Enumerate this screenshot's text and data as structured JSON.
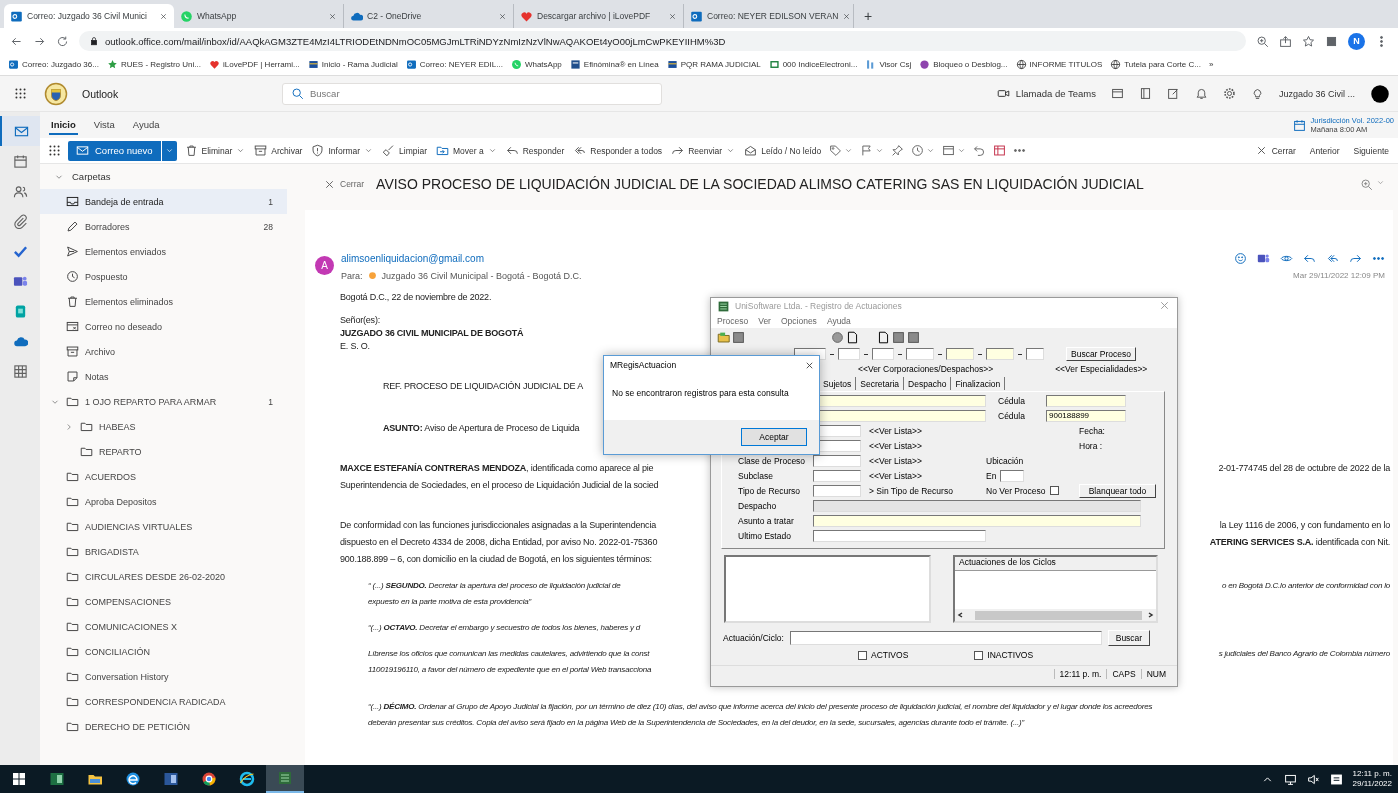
{
  "browser": {
    "tabs": [
      {
        "title": "Correo: Juzgado 36 Civil Munici",
        "kind": "outlook",
        "selected": true
      },
      {
        "title": "WhatsApp",
        "kind": "whatsapp",
        "selected": false
      },
      {
        "title": "C2 - OneDrive",
        "kind": "onedrive",
        "selected": false
      },
      {
        "title": "Descargar archivo | iLovePDF",
        "kind": "ilovepdf",
        "selected": false
      },
      {
        "title": "Correo: NEYER EDILSON VERAN",
        "kind": "outlook",
        "selected": false
      }
    ],
    "new_tab": "+",
    "url": "outlook.office.com/mail/inbox/id/AAQkAGM3ZTE4MzI4LTRIODEtNDNmOC05MGJmLTRiNDYzNmIzNzVlNwAQAKOEt4yO00jLmCwPKEYIIHM%3D",
    "profile_initial": "N",
    "bookmarks": [
      {
        "label": "Correo: Juzgado 36...",
        "kind": "outlook"
      },
      {
        "label": "RUES - Registro Uni...",
        "kind": "rues"
      },
      {
        "label": "iLovePDF | Herrami...",
        "kind": "ilovepdf"
      },
      {
        "label": "Inicio - Rama Judicial",
        "kind": "rama"
      },
      {
        "label": "Correo: NEYER EDIL...",
        "kind": "outlook"
      },
      {
        "label": "WhatsApp",
        "kind": "whatsapp"
      },
      {
        "label": "Efinómina® en Línea",
        "kind": "efinomina"
      },
      {
        "label": "PQR RAMA JUDICIAL",
        "kind": "rama"
      },
      {
        "label": "000 IndiceElectroni...",
        "kind": "indice"
      },
      {
        "label": "Visor Csj",
        "kind": "visor"
      },
      {
        "label": "Bloqueo o Desblog...",
        "kind": "bloqueo"
      },
      {
        "label": "INFORME TITULOS",
        "kind": "globe"
      },
      {
        "label": "Tutela para Corte C...",
        "kind": "globe"
      }
    ],
    "more_bookmarks": "»"
  },
  "outlook": {
    "app_name": "Outlook",
    "search": {
      "placeholder": "Buscar"
    },
    "teams_call": "Llamada de Teams",
    "account": "Juzgado 36 Civil ...",
    "app_rail": [
      {
        "kind": "mail",
        "selected": true
      },
      {
        "kind": "calendar",
        "selected": false
      },
      {
        "kind": "people",
        "selected": false
      },
      {
        "kind": "attachment",
        "selected": false
      },
      {
        "kind": "todo",
        "selected": false
      },
      {
        "kind": "teams",
        "selected": false
      },
      {
        "kind": "bookings",
        "selected": false
      },
      {
        "kind": "onedrive",
        "selected": false
      },
      {
        "kind": "apps",
        "selected": false
      }
    ],
    "ribbon_tabs": [
      {
        "label": "Inicio",
        "selected": true
      },
      {
        "label": "Vista",
        "selected": false
      },
      {
        "label": "Ayuda",
        "selected": false
      }
    ],
    "reminder": {
      "title": "Jurisdicción Vol. 2022-00",
      "time": "Mañana 8:00 AM"
    },
    "new_mail": "Correo nuevo",
    "toolbar": [
      {
        "label": "Eliminar",
        "kind": "delete",
        "dropdown": true
      },
      {
        "label": "Archivar",
        "kind": "archive",
        "dropdown": false
      },
      {
        "label": "Informar",
        "kind": "report",
        "dropdown": true
      },
      {
        "label": "Limpiar",
        "kind": "sweep",
        "dropdown": false
      },
      {
        "label": "Mover a",
        "kind": "move",
        "dropdown": true
      },
      {
        "label": "Responder",
        "kind": "reply",
        "dropdown": false
      },
      {
        "label": "Responder a todos",
        "kind": "reply-all",
        "dropdown": false
      },
      {
        "label": "Reenviar",
        "kind": "forward",
        "dropdown": true
      },
      {
        "label": "Leído / No leído",
        "kind": "read",
        "dropdown": false
      },
      {
        "kind": "tag",
        "dropdown": true
      },
      {
        "kind": "flag",
        "dropdown": true
      },
      {
        "kind": "pin",
        "dropdown": false
      },
      {
        "kind": "snooze",
        "dropdown": true
      },
      {
        "kind": "view",
        "dropdown": true
      },
      {
        "kind": "undo",
        "dropdown": false
      },
      {
        "kind": "grid",
        "dropdown": false
      },
      {
        "kind": "more",
        "dropdown": false
      }
    ],
    "close": "Cerrar",
    "previous": "Anterior",
    "next": "Siguiente",
    "folders_header": "Carpetas",
    "folders": [
      {
        "label": "Bandeja de entrada",
        "kind": "inbox",
        "count": "1",
        "selected": true
      },
      {
        "label": "Borradores",
        "kind": "drafts",
        "count": "28",
        "selected": false
      },
      {
        "label": "Elementos enviados",
        "kind": "sent",
        "selected": false
      },
      {
        "label": "Pospuesto",
        "kind": "snooze",
        "selected": false
      },
      {
        "label": "Elementos eliminados",
        "kind": "deleted",
        "selected": false
      },
      {
        "label": "Correo no deseado",
        "kind": "junk",
        "selected": false
      },
      {
        "label": "Archivo",
        "kind": "archive",
        "selected": false
      },
      {
        "label": "Notas",
        "kind": "notes",
        "selected": false
      },
      {
        "label": "1 OJO REPARTO PARA ARMAR",
        "kind": "folder",
        "count": "1",
        "selected": false,
        "expanded": true,
        "children": [
          {
            "label": "HABEAS",
            "kind": "folder",
            "selected": false,
            "expanded": false
          },
          {
            "label": "REPARTO",
            "kind": "folder",
            "selected": false
          }
        ]
      },
      {
        "label": "ACUERDOS",
        "kind": "folder",
        "selected": false
      },
      {
        "label": "Aproba Depositos",
        "kind": "folder",
        "selected": false
      },
      {
        "label": "AUDIENCIAS VIRTUALES",
        "kind": "folder",
        "selected": false
      },
      {
        "label": "BRIGADISTA",
        "kind": "folder",
        "selected": false
      },
      {
        "label": "CIRCULARES DESDE 26-02-2020",
        "kind": "folder",
        "selected": false
      },
      {
        "label": "COMPENSACIONES",
        "kind": "folder",
        "selected": false
      },
      {
        "label": "COMUNICACIONES X",
        "kind": "folder",
        "selected": false
      },
      {
        "label": "CONCILIACIÓN",
        "kind": "folder",
        "selected": false
      },
      {
        "label": "Conversation History",
        "kind": "folder",
        "selected": false
      },
      {
        "label": "CORRESPONDENCIA RADICADA",
        "kind": "folder",
        "selected": false
      },
      {
        "label": "DERECHO DE PETICIÓN",
        "kind": "folder",
        "selected": false
      }
    ],
    "reading": {
      "close": "Cerrar",
      "subject": "AVISO PROCESO DE LIQUIDACIÓN JUDICIAL DE LA SOCIEDAD ALIMSO CATERING SAS EN LIQUIDACIÓN JUDICIAL",
      "avatar_initial": "A",
      "sender": "alimsoenliquidacion@gmail.com",
      "to_label": "Para:",
      "to": "Juzgado 36 Civil Municipal - Bogotá - Bogotá D.C.",
      "date": "Mar 29/11/2022 12:09 PM",
      "body": [
        {
          "kind": "date",
          "lines": [
            {
              "left": "Bogotá D.C., 22 de noviembre de 2022."
            }
          ]
        },
        {
          "kind": "salutation",
          "lines": [
            {
              "left": "Señor(es):"
            }
          ]
        },
        {
          "kind": "addressee",
          "lines": [
            {
              "left": "JUZGADO 36 CIVIL MUNICIPAL DE BOGOTÁ"
            }
          ]
        },
        {
          "kind": "address",
          "lines": [
            {
              "left": "E. S. O."
            }
          ]
        },
        {
          "kind": "ref",
          "lines": [
            {
              "left": "REF. PROCESO DE LIQUIDACIÓN JUDICIAL DE A"
            }
          ]
        },
        {
          "kind": "ref",
          "lines": [
            {
              "left": "**ASUNTO:** Aviso de Apertura de Proceso de Liquida"
            }
          ]
        },
        {
          "kind": "para",
          "lines": [
            {
              "left": "**MAXCE ESTEFANÍA CONTRERAS MENDOZA**, identificada como aparece al pie",
              "right": "2-01-774745 del 28 de octubre de 2022 de la"
            },
            {
              "left": "Superintendencia de Sociedades, en el proceso de Liquidación Judicial de la socied"
            }
          ]
        },
        {
          "kind": "para",
          "lines": [
            {
              "left": "De conformidad con las funciones jurisdiccionales asignadas a la Superintendencia",
              "right": "la Ley 1116 de 2006, y con fundamento en lo"
            },
            {
              "left": "dispuesto en el Decreto 4334 de 2008, dicha Entidad, por aviso No. 2022-01-75360",
              "right": "**ATERING SERVICES S.A.** identificada con Nit."
            },
            {
              "left": "900.188.899 – 6, con domicilio en la ciudad de Bogotá, en los siguientes términos:"
            }
          ]
        },
        {
          "kind": "quote",
          "lines": [
            {
              "left": "“ (...) **SEGUNDO.** Decretar la apertura del proceso de liquidación judicial de",
              "right": "o en Bogotá D.C.lo anterior de conformidad con lo"
            },
            {
              "left": "expuesto en la parte motiva de esta providencia”"
            }
          ]
        },
        {
          "kind": "quote",
          "lines": [
            {
              "left": "“(...) **OCTAVO.** Decretar el embargo y secuestro de todos los bienes, haberes y d"
            }
          ]
        },
        {
          "kind": "quote",
          "lines": [
            {
              "left": "Líbrense los oficios que comunican las medidas cautelares, advirtiendo que la const",
              "right": "s judiciales del Banco Agrario de Colombia número"
            },
            {
              "left": "110019196110, a favor del número de expediente que en el portal Web transacciona"
            }
          ]
        },
        {
          "kind": "quote-wide",
          "lines": [
            {
              "left": "“(...) **DÉCIMO.** Ordenar al Grupo de Apoyo Judicial la fijación, por un término de diez (10) días, del aviso que informe acerca del inicio del presente proceso de liquidación judicial, el nombre del liquidador y el lugar donde los acreedores"
            },
            {
              "left": "deberán presentar sus créditos. Copia del aviso será fijado en la página Web de la Superintendencia de Sociedades, en la del deudor, en la sede, sucursales, agencias durante todo el trámite. (...)”"
            }
          ]
        }
      ]
    }
  },
  "unisoftware": {
    "title": "UniSoftware Ltda. - Registro de Actuaciones",
    "menu": [
      "Proceso",
      "Ver",
      "Opciones",
      "Ayuda"
    ],
    "search_process": "Buscar Proceso",
    "links": [
      "<<Ver Corporaciones/Despachos>>",
      "<<Ver Especialidades>>"
    ],
    "tabs": [
      {
        "label": "Sujetos",
        "selected": false
      },
      {
        "label": "Secretaria",
        "selected": false
      },
      {
        "label": "Despacho",
        "selected": false
      },
      {
        "label": "Finalizacion",
        "selected": false
      }
    ],
    "id_rows": [
      {
        "label": "Cédula"
      },
      {
        "label": "Cédula",
        "value": "900188899"
      }
    ],
    "list_rows": [
      {
        "link": "<<Ver Lista>>"
      },
      {
        "link": "<<Ver Lista>>"
      },
      {
        "label": "Clase de Proceso",
        "link": "<<Ver Lista>>"
      },
      {
        "label": "Subclase",
        "link": "<<Ver Lista>>"
      }
    ],
    "fecha": "Fecha:",
    "hora": "Hora :",
    "ubicacion": "Ubicación",
    "en": "En",
    "tipo_recurso": {
      "label": "Tipo de Recurso",
      "note": "> Sin Tipo de Recurso"
    },
    "no_ver_proceso": {
      "label": "No Ver Proceso",
      "checked": false
    },
    "clear_all": "Blanquear todo",
    "despacho": "Despacho",
    "asunto": "Asunto a tratar",
    "ultimo_estado": "Ultimo Estado",
    "cycles_header": "Actuaciones de los Ciclos",
    "actuacion_label": "Actuación/Ciclo:",
    "search": "Buscar",
    "filters": [
      {
        "label": "ACTIVOS",
        "checked": false
      },
      {
        "label": "INACTIVOS",
        "checked": false
      }
    ],
    "status": [
      "12:11 p. m.",
      "CAPS",
      "NUM"
    ]
  },
  "message_box": {
    "title": "MRegisActuacion",
    "message": "No se encontraron registros para esta consulta",
    "button": "Aceptar"
  },
  "taskbar": {
    "apps": [
      {
        "kind": "excel",
        "selected": false
      },
      {
        "kind": "explorer",
        "selected": false
      },
      {
        "kind": "edge",
        "selected": false
      },
      {
        "kind": "word",
        "selected": false
      },
      {
        "kind": "chrome",
        "selected": false
      },
      {
        "kind": "ie",
        "selected": false
      },
      {
        "kind": "unisoftware",
        "selected": true
      }
    ],
    "time": "12:11 p. m.",
    "date": "29/11/2022"
  }
}
